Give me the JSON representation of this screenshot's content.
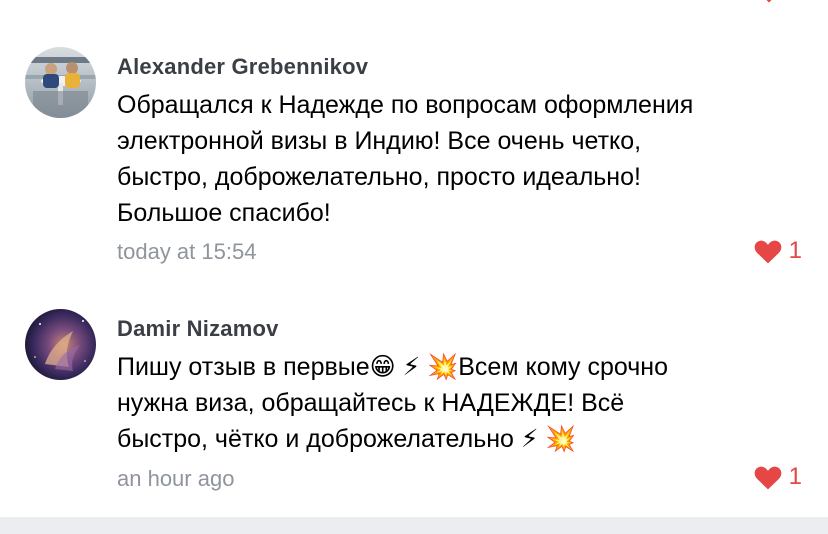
{
  "comments": [
    {
      "author": "Alexander Grebennikov",
      "text": "Обращался к Надежде по вопросам оформления\nэлектронной визы в Индию! Все очень четко,\nбыстро, доброжелательно, просто идеально!\nБольшое спасибо!",
      "time": "today at 15:54",
      "likes": "1"
    },
    {
      "author": "Damir Nizamov",
      "text": "Пишу отзыв в первые😁 ⚡ 💥Всем кому срочно\nнужна виза, обращайтесь к НАДЕЖДЕ! Всё\nбыстро, чётко и доброжелательно ⚡ 💥",
      "time": "an hour ago",
      "likes": "1"
    }
  ],
  "colors": {
    "author": "#3a3f45",
    "timestamp": "#8f959c",
    "like": "#e64646",
    "footer": "#ebedf0"
  },
  "icons": [
    "heart-icon"
  ]
}
